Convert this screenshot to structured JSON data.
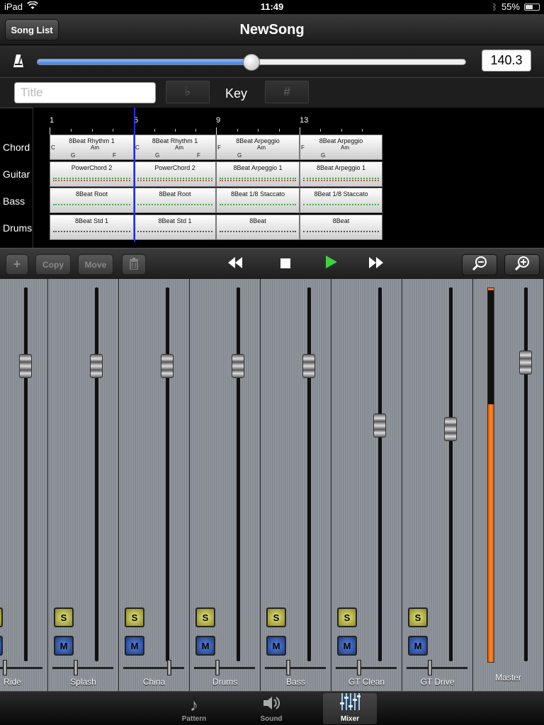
{
  "status": {
    "device": "iPad",
    "time": "11:49",
    "battery": "55%",
    "battery_level": 0.55
  },
  "nav": {
    "title": "NewSong",
    "back_label": "Song List"
  },
  "tempo": {
    "value": "140.3",
    "slider_level": 0.5
  },
  "song": {
    "title_placeholder": "Title",
    "flat_label": "♭",
    "key_label": "Key",
    "sharp_label": "#"
  },
  "arranger": {
    "measures": [
      "1",
      "5",
      "9",
      "13"
    ],
    "tracks": [
      {
        "name": "Chord",
        "patterns": [
          "8Beat Rhythm 1",
          "8Beat Rhythm 1",
          "8Beat Arpeggio",
          "8Beat Arpeggio"
        ]
      },
      {
        "name": "Guitar",
        "patterns": [
          "PowerChord 2",
          "PowerChord 2",
          "8Beat Arpeggio 1",
          "8Beat Arpeggio 1"
        ]
      },
      {
        "name": "Bass",
        "patterns": [
          "8Beat Root",
          "8Beat Root",
          "8Beat 1/8 Staccato",
          "8Beat 1/8 Staccato"
        ]
      },
      {
        "name": "Drums",
        "patterns": [
          "8Beat Std 1",
          "8Beat Std 1",
          "8Beat",
          "8Beat"
        ]
      }
    ],
    "chords": [
      [
        "C",
        "G",
        "Am",
        "F"
      ],
      [
        "C",
        "G",
        "Am",
        "F"
      ],
      [
        "F",
        "G",
        "Am"
      ],
      [
        "F",
        "G",
        "Am"
      ]
    ]
  },
  "toolbar": {
    "add_label": "+",
    "copy_label": "Copy",
    "move_label": "Move",
    "delete_label": "🗑"
  },
  "mixer": {
    "solo_label": "S",
    "mute_label": "M",
    "channels": [
      {
        "name": "Ride",
        "level": 0.81
      },
      {
        "name": "Splash",
        "level": 0.81
      },
      {
        "name": "China",
        "level": 0.81
      },
      {
        "name": "Drums",
        "level": 0.81
      },
      {
        "name": "Bass",
        "level": 0.81
      },
      {
        "name": "GT Clean",
        "level": 0.64
      },
      {
        "name": "GT Drive",
        "level": 0.63
      }
    ],
    "master": {
      "name": "Master",
      "level": 0.82,
      "meter_level": 0.69
    }
  },
  "tabs": [
    {
      "label": "Pattern",
      "icon": "music-note-icon"
    },
    {
      "label": "Sound",
      "icon": "speaker-icon"
    },
    {
      "label": "Mixer",
      "icon": "mixer-icon",
      "active": true
    }
  ]
}
